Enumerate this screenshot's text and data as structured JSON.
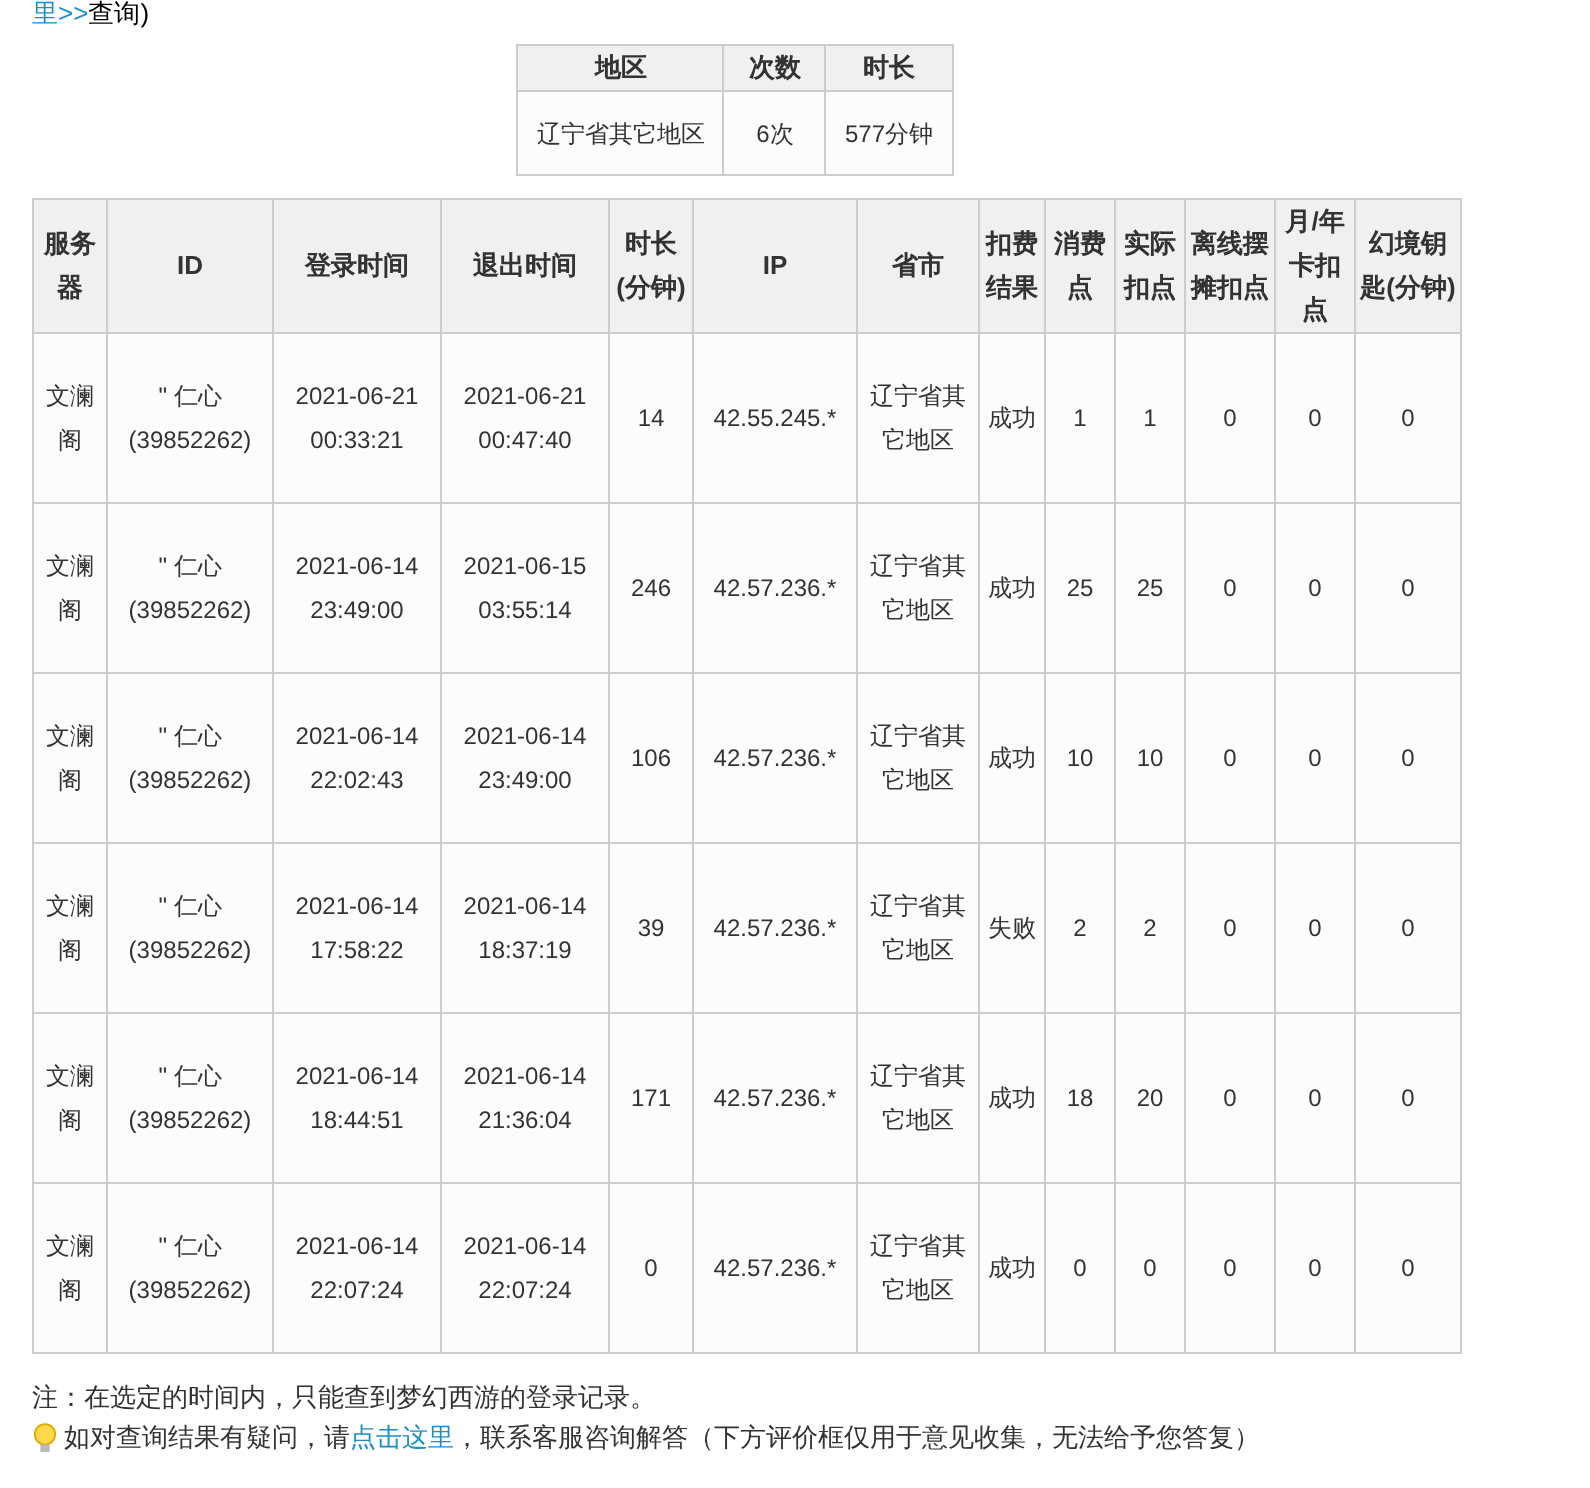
{
  "breadcrumb": {
    "link": "里>>",
    "text": "查询)"
  },
  "summary": {
    "columns": [
      "地区",
      "次数",
      "时长"
    ],
    "rows": [
      [
        "辽宁省其它地区",
        "6次",
        "577分钟"
      ]
    ]
  },
  "records": {
    "columns": [
      "服务器",
      "ID",
      "登录时间",
      "退出时间",
      "时长(分钟)",
      "IP",
      "省市",
      "扣费结果",
      "消费点",
      "实际扣点",
      "离线摆摊扣点",
      "月/年卡扣点",
      "幻境钥匙(分钟)"
    ],
    "rows": [
      [
        "文澜阁",
        "\" 仁心 (39852262)",
        "2021-06-21 00:33:21",
        "2021-06-21 00:47:40",
        "14",
        "42.55.245.*",
        "辽宁省其它地区",
        "成功",
        "1",
        "1",
        "0",
        "0",
        "0"
      ],
      [
        "文澜阁",
        "\" 仁心 (39852262)",
        "2021-06-14 23:49:00",
        "2021-06-15 03:55:14",
        "246",
        "42.57.236.*",
        "辽宁省其它地区",
        "成功",
        "25",
        "25",
        "0",
        "0",
        "0"
      ],
      [
        "文澜阁",
        "\" 仁心 (39852262)",
        "2021-06-14 22:02:43",
        "2021-06-14 23:49:00",
        "106",
        "42.57.236.*",
        "辽宁省其它地区",
        "成功",
        "10",
        "10",
        "0",
        "0",
        "0"
      ],
      [
        "文澜阁",
        "\" 仁心 (39852262)",
        "2021-06-14 17:58:22",
        "2021-06-14 18:37:19",
        "39",
        "42.57.236.*",
        "辽宁省其它地区",
        "失败",
        "2",
        "2",
        "0",
        "0",
        "0"
      ],
      [
        "文澜阁",
        "\" 仁心 (39852262)",
        "2021-06-14 18:44:51",
        "2021-06-14 21:36:04",
        "171",
        "42.57.236.*",
        "辽宁省其它地区",
        "成功",
        "18",
        "20",
        "0",
        "0",
        "0"
      ],
      [
        "文澜阁",
        "\" 仁心 (39852262)",
        "2021-06-14 22:07:24",
        "2021-06-14 22:07:24",
        "0",
        "42.57.236.*",
        "辽宁省其它地区",
        "成功",
        "0",
        "0",
        "0",
        "0",
        "0"
      ]
    ]
  },
  "note": "注：在选定的时间内，只能查到梦幻西游的登录记录。",
  "tip": {
    "before": "如对查询结果有疑问，请",
    "link": "点击这里",
    "after": "，联系客服咨询解答（下方评价框仅用于意见收集，无法给予您答复）"
  }
}
